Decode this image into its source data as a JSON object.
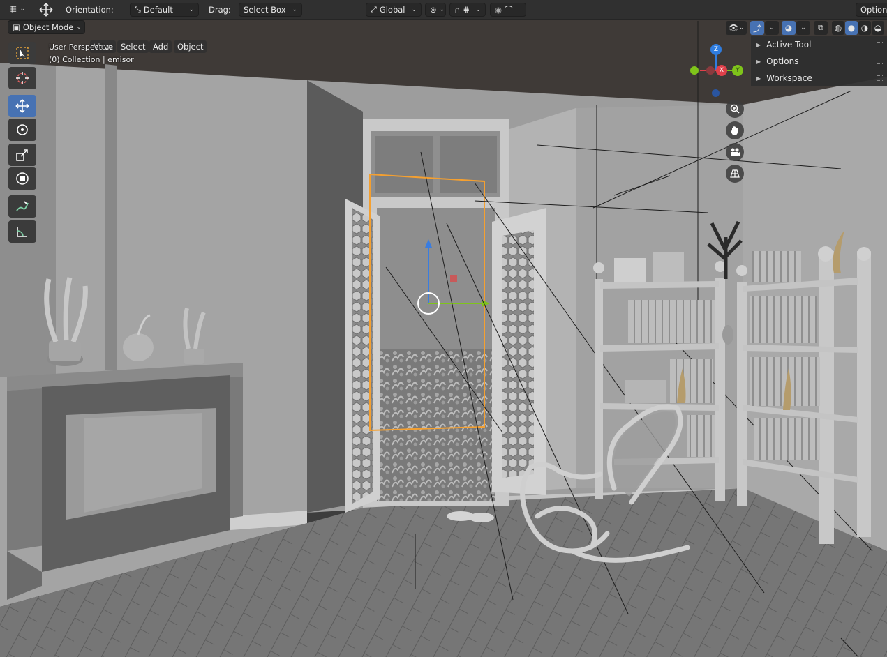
{
  "header": {
    "orientation_label": "Orientation:",
    "orientation_value": "Default",
    "drag_label": "Drag:",
    "drag_value": "Select Box",
    "transform_space": "Global",
    "options_label": "Options"
  },
  "viewport_header": {
    "mode": "Object Mode",
    "menus": [
      "View",
      "Select",
      "Add",
      "Object"
    ]
  },
  "overlay": {
    "perspective": "User Perspective",
    "collection": "(0) Collection | emisor"
  },
  "gizmo": {
    "z": "Z",
    "x": "X",
    "y": "Y"
  },
  "side_panel": {
    "items": [
      "Active Tool",
      "Options",
      "Workspace"
    ]
  },
  "colors": {
    "active_tool": "#4772b3",
    "selection_outline": "#f5a030",
    "axis_x": "#e0404a",
    "axis_y": "#7fc41a",
    "axis_z": "#2f7de0"
  },
  "icons": {
    "tools": [
      "select-box-icon",
      "cursor-icon",
      "move-icon",
      "rotate-icon",
      "scale-icon",
      "transform-icon",
      "annotate-icon",
      "measure-icon"
    ],
    "nav": [
      "zoom-icon",
      "pan-hand-icon",
      "camera-icon",
      "perspective-grid-icon"
    ]
  }
}
